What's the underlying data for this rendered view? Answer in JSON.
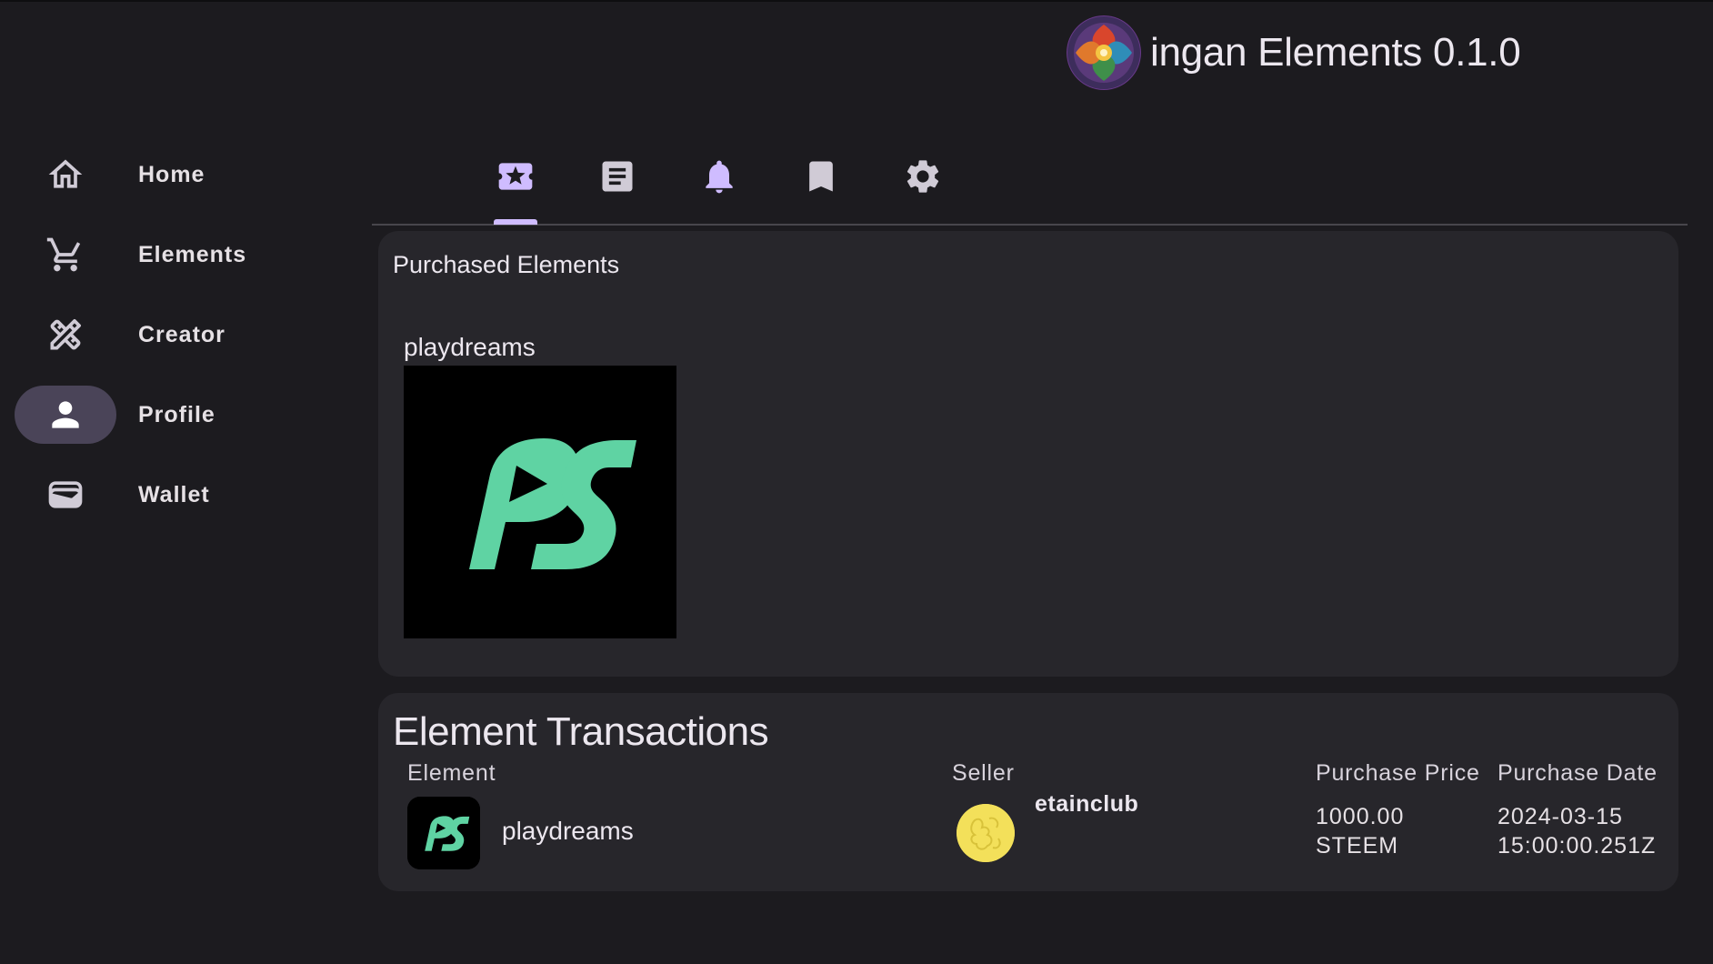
{
  "app": {
    "title": "ingan Elements 0.1.0",
    "logo_icon": "app-logo"
  },
  "nav": {
    "items": [
      {
        "label": "Home",
        "icon": "home-icon",
        "active": false
      },
      {
        "label": "Elements",
        "icon": "cart-icon",
        "active": false
      },
      {
        "label": "Creator",
        "icon": "design-pencil-icon",
        "active": false
      },
      {
        "label": "Profile",
        "icon": "person-icon",
        "active": true
      },
      {
        "label": "Wallet",
        "icon": "wallet-icon",
        "active": false
      }
    ]
  },
  "tabs": [
    {
      "icon": "ticket-star-icon",
      "active": true
    },
    {
      "icon": "article-icon",
      "active": false
    },
    {
      "icon": "bell-icon",
      "active": false
    },
    {
      "icon": "bookmark-icon",
      "active": false
    },
    {
      "icon": "gear-icon",
      "active": false
    }
  ],
  "purchased": {
    "title": "Purchased Elements",
    "items": [
      {
        "name": "playdreams",
        "image": "playdreams-logo"
      }
    ]
  },
  "transactions": {
    "title": "Element Transactions",
    "columns": {
      "element": "Element",
      "seller": "Seller",
      "price": "Purchase Price",
      "date": "Purchase Date"
    },
    "rows": [
      {
        "element": "playdreams",
        "seller": "etainclub",
        "price_amount": "1000.00",
        "price_currency": "STEEM",
        "date": "2024-03-15",
        "time": "15:00:00.251Z"
      }
    ]
  },
  "colors": {
    "background": "#1c1b1f",
    "card": "#27262b",
    "accent": "#cfbcff",
    "active_pill": "#4a4458",
    "brand_green": "#5fd3a3"
  }
}
